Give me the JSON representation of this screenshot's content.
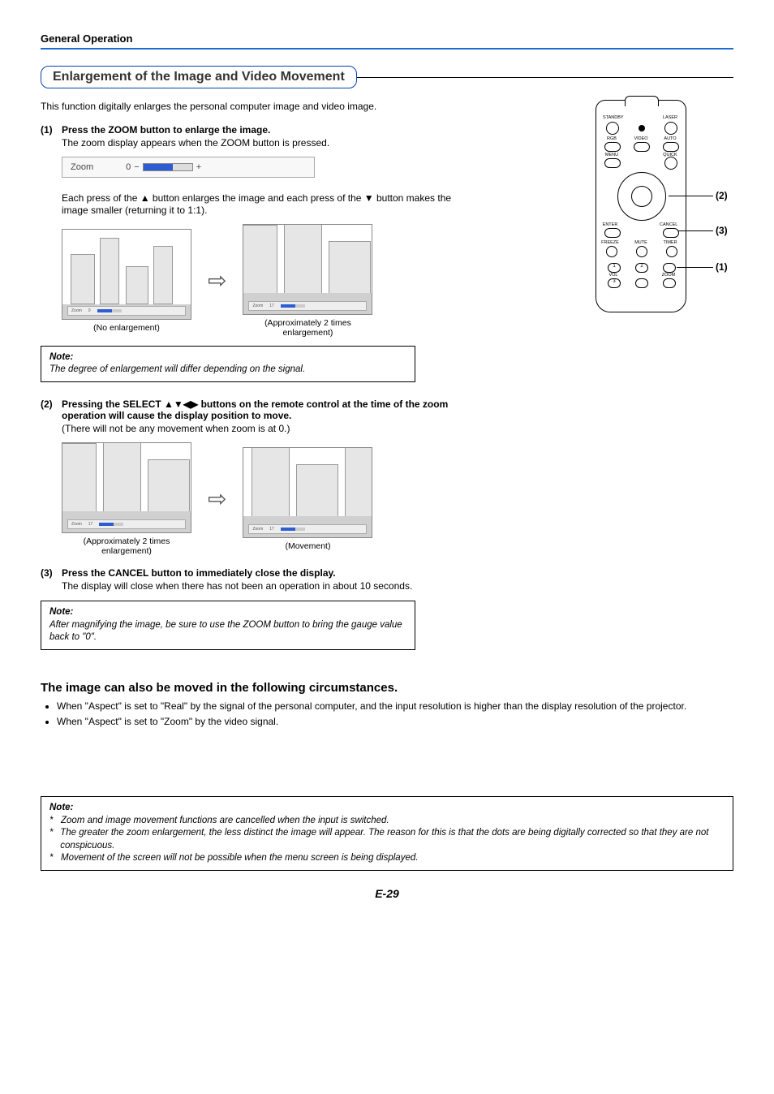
{
  "header": "General Operation",
  "section_title": "Enlargement of the Image and Video Movement",
  "intro": "This function digitally enlarges the personal computer image and video image.",
  "step1": {
    "num": "(1)",
    "title": "Press the ZOOM button to enlarge the image.",
    "sub": "The zoom display appears when the ZOOM button is pressed.",
    "desc": "Each press of the ▲ button enlarges the image and each press of the ▼ button makes the image smaller (returning it to 1:1)."
  },
  "zoom_bar": {
    "label": "Zoom",
    "value": "0",
    "minus": "−",
    "plus": "+"
  },
  "fig1a_cap": "(No enlargement)",
  "fig1b_cap": "(Approximately 2 times enlargement)",
  "note1": {
    "label": "Note:",
    "text": "The degree of enlargement will differ depending on the signal."
  },
  "step2": {
    "num": "(2)",
    "title": "Pressing the SELECT ▲▼◀▶ buttons on the remote control at the time of the zoom operation will cause the display position to move.",
    "sub": "(There will not be any movement when zoom is at 0.)"
  },
  "fig2a_cap": "(Approximately 2 times enlargement)",
  "fig2b_cap": "(Movement)",
  "step3": {
    "num": "(3)",
    "title": "Press the CANCEL button to immediately close the display.",
    "sub": "The display will close when there has not been an operation in about 10 seconds."
  },
  "note2": {
    "label": "Note:",
    "text": "After magnifying the image, be sure to use the ZOOM button to bring the gauge value back to \"0\"."
  },
  "sub_heading": "The image can also be moved in the following circumstances.",
  "bullets": [
    "When \"Aspect\" is set to \"Real\" by the signal of the personal computer, and the input resolution is higher than the display resolution of the projector.",
    "When \"Aspect\" is set to \"Zoom\" by the video signal."
  ],
  "note3": {
    "label": "Note:",
    "items": [
      "Zoom and image movement functions are cancelled when the input is switched.",
      "The greater the zoom enlargement, the less distinct the image will appear. The reason for this is that the dots are being digitally corrected so that they are not conspicuous.",
      "Movement of the screen will not be possible when the menu screen is being displayed."
    ]
  },
  "remote": {
    "labels": {
      "standby": "STANDBY",
      "laser": "LASER",
      "rgb": "RGB",
      "video": "VIDEO",
      "auto": "AUTO",
      "menu": "MENU",
      "quick": "QUICK",
      "enter": "ENTER",
      "cancel": "CANCEL",
      "freeze": "FREEZE",
      "mute": "MUTE",
      "timer": "TIMER",
      "vol": "VOL",
      "zoom": "ZOOM",
      "b1": "1",
      "b2": "2",
      "b3": "3"
    },
    "callouts": {
      "c1": "(1)",
      "c2": "(2)",
      "c3": "(3)"
    }
  },
  "page_num": "E-29",
  "mini_zoom_label": "Zoom",
  "mini_zoom_val_a": "0",
  "mini_zoom_val_b": "17"
}
